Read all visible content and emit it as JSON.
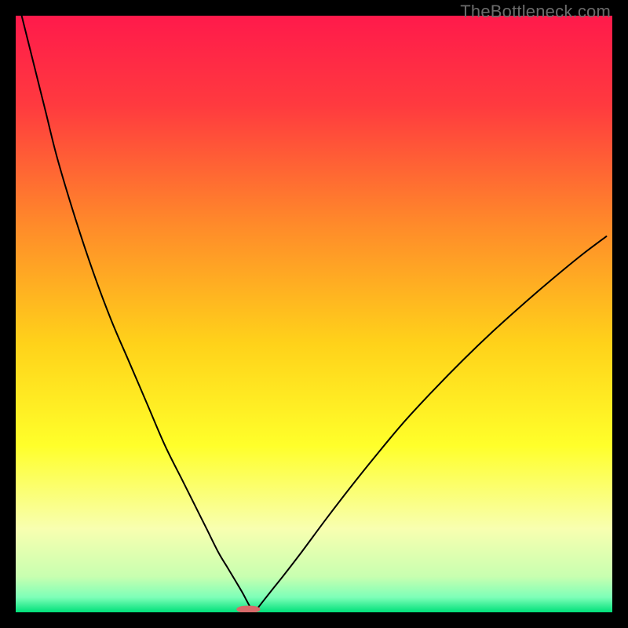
{
  "watermark": "TheBottleneck.com",
  "chart_data": {
    "type": "line",
    "title": "",
    "xlabel": "",
    "ylabel": "",
    "xlim": [
      0,
      100
    ],
    "ylim": [
      0,
      100
    ],
    "background_gradient_stops": [
      {
        "offset": 0.0,
        "color": "#ff1a4b"
      },
      {
        "offset": 0.15,
        "color": "#ff3a3f"
      },
      {
        "offset": 0.35,
        "color": "#ff8a2a"
      },
      {
        "offset": 0.55,
        "color": "#ffd21a"
      },
      {
        "offset": 0.72,
        "color": "#ffff2a"
      },
      {
        "offset": 0.86,
        "color": "#f8ffb0"
      },
      {
        "offset": 0.94,
        "color": "#c8ffb0"
      },
      {
        "offset": 0.975,
        "color": "#7dffb8"
      },
      {
        "offset": 1.0,
        "color": "#00e07a"
      }
    ],
    "curve_color": "#000000",
    "curve_width": 2,
    "marker": {
      "x": 39,
      "y": 0.5,
      "width": 4,
      "height": 1.2,
      "color": "#d86a6a",
      "rx": 1.6
    },
    "series": [
      {
        "name": "left-branch",
        "x": [
          1,
          3,
          5,
          7,
          10,
          13,
          16,
          19,
          22,
          25,
          28,
          30,
          32,
          34,
          35.5,
          37,
          38,
          38.8,
          39.3,
          39.7
        ],
        "y": [
          100,
          92,
          84,
          76,
          66,
          57,
          49,
          42,
          35,
          28,
          22,
          18,
          14,
          10,
          7.5,
          5,
          3.3,
          1.8,
          0.9,
          0.4
        ]
      },
      {
        "name": "right-branch",
        "x": [
          40.3,
          40.8,
          41.5,
          43,
          45,
          48,
          52,
          56,
          60,
          65,
          70,
          75,
          80,
          85,
          90,
          95,
          99
        ],
        "y": [
          0.4,
          1.0,
          1.9,
          3.8,
          6.3,
          10.2,
          15.6,
          20.8,
          25.8,
          31.8,
          37.2,
          42.3,
          47.1,
          51.6,
          55.9,
          60.0,
          63.0
        ]
      }
    ]
  }
}
